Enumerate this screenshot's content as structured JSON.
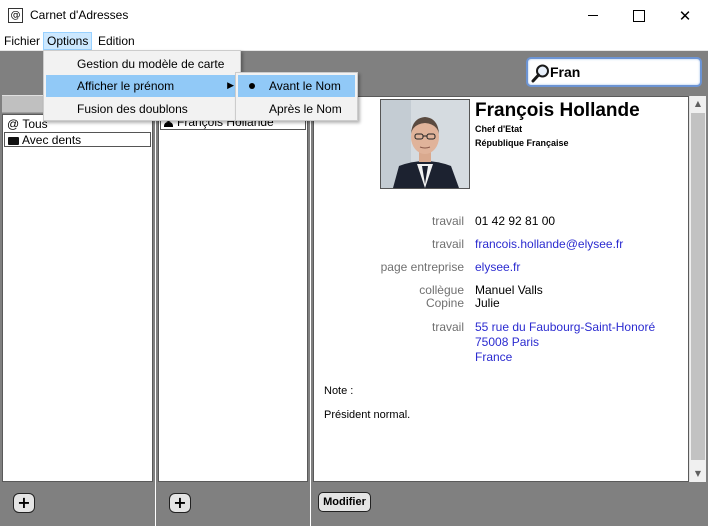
{
  "window": {
    "title": "Carnet d'Adresses",
    "app_icon_glyph": "@"
  },
  "menubar": {
    "fichier": "Fichier",
    "options": "Options",
    "edition": "Edition"
  },
  "options_menu": {
    "items": [
      {
        "label": "Gestion du modèle de carte"
      },
      {
        "label": "Afficher le prénom",
        "has_submenu": true
      },
      {
        "label": "Fusion des doublons"
      }
    ],
    "submenu": {
      "items": [
        {
          "label": "Avant le Nom",
          "selected": true
        },
        {
          "label": "Après le Nom",
          "selected": false
        }
      ]
    }
  },
  "search": {
    "value": "Fran",
    "icon": "magnifier-icon"
  },
  "groups": {
    "items": [
      {
        "label": "Tous",
        "icon": "at-icon"
      },
      {
        "label": "Avec dents",
        "icon": "folder-icon"
      }
    ],
    "add_label": "+"
  },
  "contacts": {
    "items": [
      {
        "label": "François Hollande",
        "icon": "person-icon"
      }
    ],
    "add_label": "+"
  },
  "card": {
    "name": "François Hollande",
    "title": "Chef d'Etat",
    "organization": "République Française",
    "fields": [
      {
        "label": "travail",
        "value": "01 42 92 81 00"
      },
      {
        "label": "travail",
        "value": "francois.hollande@elysee.fr"
      },
      {
        "label": "page entreprise",
        "value": "elysee.fr"
      },
      {
        "label": "collègue",
        "value": "Manuel Valls"
      },
      {
        "label": "Copine",
        "value": "Julie"
      },
      {
        "label": "travail",
        "address": [
          "55 rue du Faubourg-Saint-Honoré",
          "75008 Paris",
          "France"
        ]
      }
    ],
    "note_label": "Note :",
    "note_text": "Président normal.",
    "modify_label": "Modifier"
  },
  "colors": {
    "toolbar_gray": "#808080",
    "link_blue": "#2b2bd0",
    "menu_highlight": "#91c9f7",
    "search_border": "#6c94d4"
  }
}
